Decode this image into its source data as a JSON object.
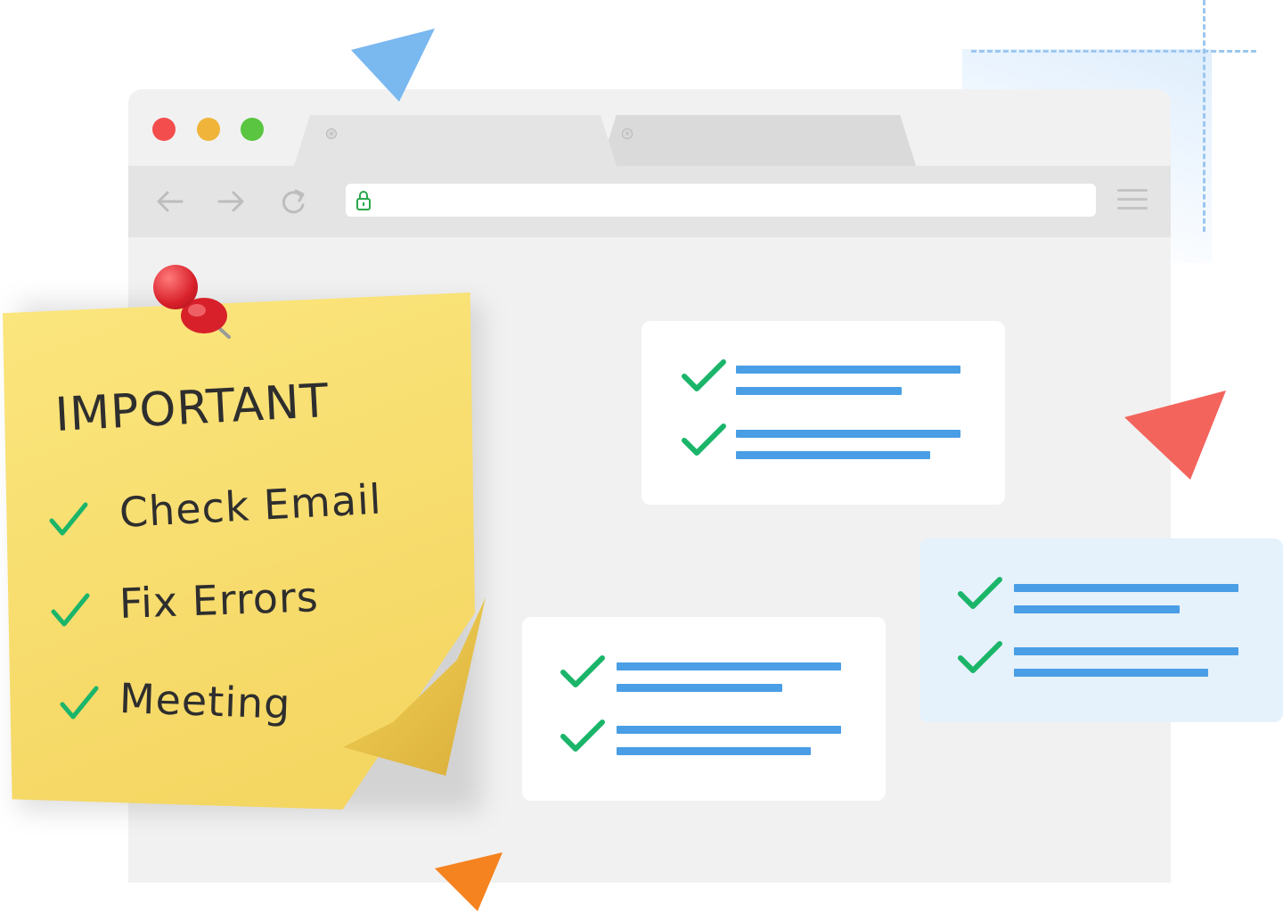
{
  "note": {
    "title": "IMPORTANT",
    "items": [
      "Check Email",
      "Fix Errors",
      "Meeting"
    ]
  },
  "browser": {
    "window_controls": [
      "close",
      "minimize",
      "maximize"
    ],
    "tabs": [
      {
        "label": ""
      },
      {
        "label": ""
      }
    ],
    "url": "",
    "icons": [
      "back-arrow-icon",
      "forward-arrow-icon",
      "reload-icon",
      "lock-icon",
      "hamburger-menu-icon"
    ]
  },
  "cards": [
    {
      "name": "checklist-card-top",
      "items": 2
    },
    {
      "name": "checklist-card-right",
      "items": 2
    },
    {
      "name": "checklist-card-bottom",
      "items": 2
    }
  ],
  "colors": {
    "check_green": "#1bb56a",
    "line_blue": "#4a9ee5",
    "triangle_blue": "#7ab8f0",
    "triangle_red": "#f3645c",
    "triangle_orange": "#f5831f",
    "note_yellow": "#f7dc6d"
  }
}
